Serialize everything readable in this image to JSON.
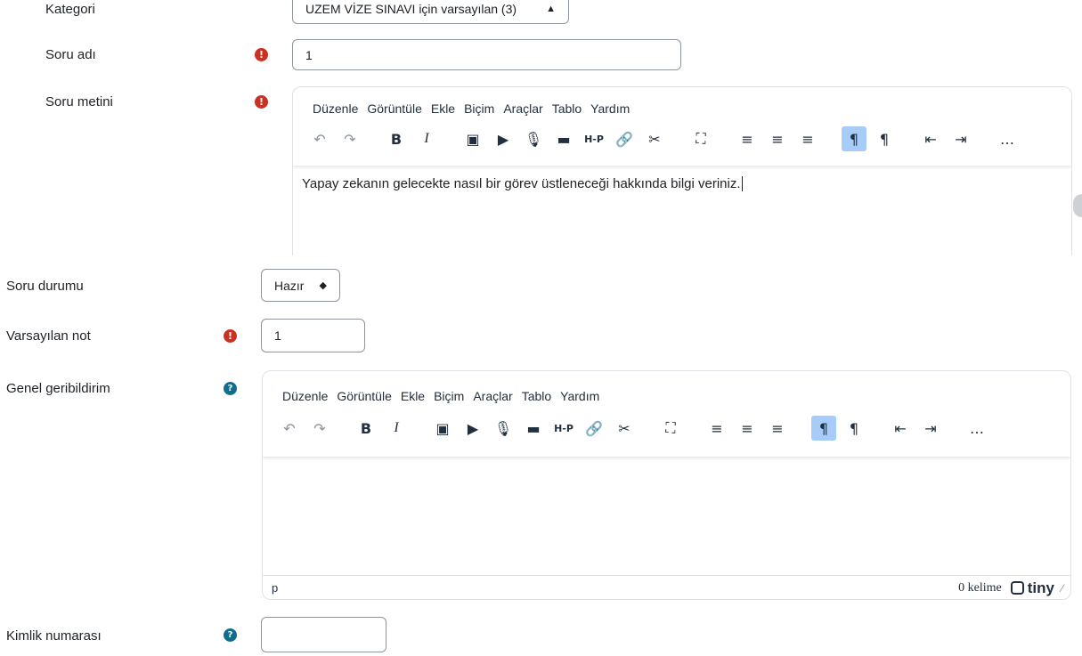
{
  "form": {
    "kategori": {
      "label": "Kategori",
      "value": "UZEM VİZE SINAVI için varsayılan (3)"
    },
    "soru_adi": {
      "label": "Soru adı",
      "value": "1"
    },
    "soru_metini": {
      "label": "Soru metini",
      "content": "Yapay zekanın gelecekte nasıl bir görev üstleneceği hakkında bilgi veriniz."
    },
    "soru_durumu": {
      "label": "Soru durumu",
      "value": "Hazır"
    },
    "varsayilan_not": {
      "label": "Varsayılan not",
      "value": "1"
    },
    "genel_geribildirim": {
      "label": "Genel geribildirim",
      "content": ""
    },
    "kimlik_numarasi": {
      "label": "Kimlik numarası",
      "value": ""
    }
  },
  "editor": {
    "menu": [
      "Düzenle",
      "Görüntüle",
      "Ekle",
      "Biçim",
      "Araçlar",
      "Tablo",
      "Yardım"
    ],
    "toolbar_icons": [
      "undo-icon",
      "redo-icon",
      "bold-icon",
      "italic-icon",
      "image-icon",
      "media-icon",
      "microphone-icon",
      "video-icon",
      "h5p-icon",
      "link-icon",
      "unlink-icon",
      "fullscreen-icon",
      "align-left-icon",
      "align-center-icon",
      "align-right-icon",
      "ltr-icon",
      "rtl-icon",
      "outdent-icon",
      "indent-icon",
      "more-icon"
    ],
    "bold_label": "B",
    "italic_label": "I",
    "h5p_label": "H-P",
    "status_path": "p",
    "word_count": "0 kelime",
    "brand": "tiny"
  },
  "icons": {
    "required": "!",
    "help": "?"
  },
  "colors": {
    "required": "#ca3120",
    "help": "#0f6e8c",
    "active_button": "#a6ccf7"
  }
}
